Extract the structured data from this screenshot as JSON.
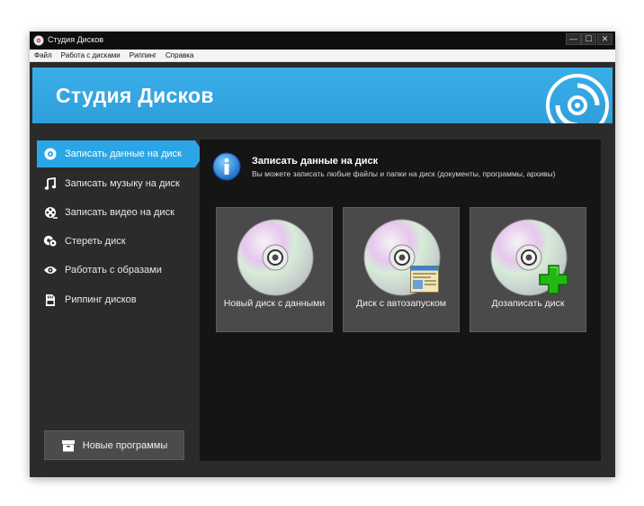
{
  "window": {
    "title": "Студия Дисков",
    "controls": {
      "minimize": "—",
      "maximize": "☐",
      "close": "✕"
    }
  },
  "menu": [
    "Файл",
    "Работа с дисками",
    "Риппинг",
    "Справка"
  ],
  "banner": {
    "title": "Студия Дисков",
    "logo_icon": "disc-logo-icon"
  },
  "sidebar": {
    "items": [
      {
        "label": "Записать данные на диск",
        "icon": "disc-icon",
        "active": true
      },
      {
        "label": "Записать музыку на диск",
        "icon": "music-note-icon",
        "active": false
      },
      {
        "label": "Записать видео на диск",
        "icon": "film-reel-icon",
        "active": false
      },
      {
        "label": "Стереть диск",
        "icon": "erase-disc-icon",
        "active": false
      },
      {
        "label": "Работать с образами",
        "icon": "eye-icon",
        "active": false
      },
      {
        "label": "Риппинг дисков",
        "icon": "sd-card-icon",
        "active": false
      }
    ],
    "new_programs_label": "Новые программы",
    "new_programs_icon": "box-icon"
  },
  "content": {
    "heading": "Записать данные на диск",
    "subtitle": "Вы можете записать любые файлы и папки на диск (документы, программы, архивы)",
    "info_icon": "info-icon",
    "tiles": [
      {
        "label": "Новый диск с данными",
        "icon": "disc-icon"
      },
      {
        "label": "Диск с автозапуском",
        "icon": "disc-autorun-icon"
      },
      {
        "label": "Дозаписать диск",
        "icon": "disc-add-icon"
      }
    ]
  },
  "colors": {
    "accent": "#2aa6e6",
    "banner": "#35a8e4",
    "window_bg": "#2b2b2b",
    "content_bg": "#151515",
    "tile_bg": "#4a4a4a",
    "plus_green": "#22b814"
  }
}
